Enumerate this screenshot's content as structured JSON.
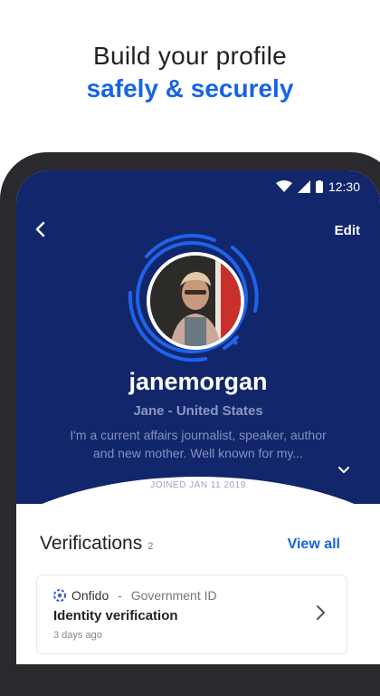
{
  "headline": {
    "line1": "Build your profile",
    "line2": "safely & securely"
  },
  "status_bar": {
    "time": "12:30"
  },
  "profile": {
    "edit_label": "Edit",
    "username": "janemorgan",
    "subname": "Jane - United States",
    "bio_line1": "I'm a current affairs journalist, speaker, author",
    "bio_line2": "and new mother. Well known for my...",
    "joined": "JOINED JAN 11 2019"
  },
  "verifications": {
    "title": "Verifications",
    "count": "2",
    "view_all": "View all",
    "items": [
      {
        "provider": "Onfido",
        "separator": " - ",
        "type": "Government ID",
        "name": "Identity verification",
        "time": "3 days ago"
      }
    ]
  },
  "colors": {
    "hero": "#12266b",
    "accent": "#1763e6",
    "ring": "#1e63e9"
  }
}
